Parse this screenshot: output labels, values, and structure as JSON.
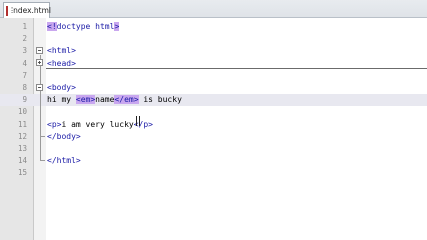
{
  "tabs": [
    {
      "label": "index.html",
      "icon": "html-file-icon",
      "active": true
    }
  ],
  "editor": {
    "current_line": 9,
    "lines": [
      {
        "n": "1",
        "parts": [
          {
            "t": "tag-hl",
            "v": "<!"
          },
          {
            "t": "tag",
            "v": "doctype html"
          },
          {
            "t": "tag-hl",
            "v": ">"
          }
        ]
      },
      {
        "n": "2",
        "parts": []
      },
      {
        "n": "3",
        "parts": [
          {
            "t": "tag",
            "v": "<html>"
          }
        ]
      },
      {
        "n": "4",
        "parts": [
          {
            "t": "tag",
            "v": "<head>"
          }
        ]
      },
      {
        "n": "7",
        "parts": []
      },
      {
        "n": "8",
        "parts": [
          {
            "t": "tag",
            "v": "<body>"
          }
        ]
      },
      {
        "n": "9",
        "parts": [
          {
            "t": "txt",
            "v": "hi my "
          },
          {
            "t": "tag-hl",
            "v": "<em>"
          },
          {
            "t": "txt",
            "v": "name"
          },
          {
            "t": "tag-hl",
            "v": "</em>"
          },
          {
            "t": "txt",
            "v": " is bucky"
          }
        ]
      },
      {
        "n": "10",
        "parts": []
      },
      {
        "n": "11",
        "parts": [
          {
            "t": "tag",
            "v": "<p>"
          },
          {
            "t": "txt",
            "v": "i am very lucky"
          },
          {
            "t": "tag",
            "v": "</p>"
          }
        ]
      },
      {
        "n": "12",
        "parts": [
          {
            "t": "tag",
            "v": "</body>"
          }
        ]
      },
      {
        "n": "13",
        "parts": []
      },
      {
        "n": "14",
        "parts": [
          {
            "t": "tag",
            "v": "</html>"
          }
        ]
      },
      {
        "n": "15",
        "parts": []
      }
    ]
  }
}
